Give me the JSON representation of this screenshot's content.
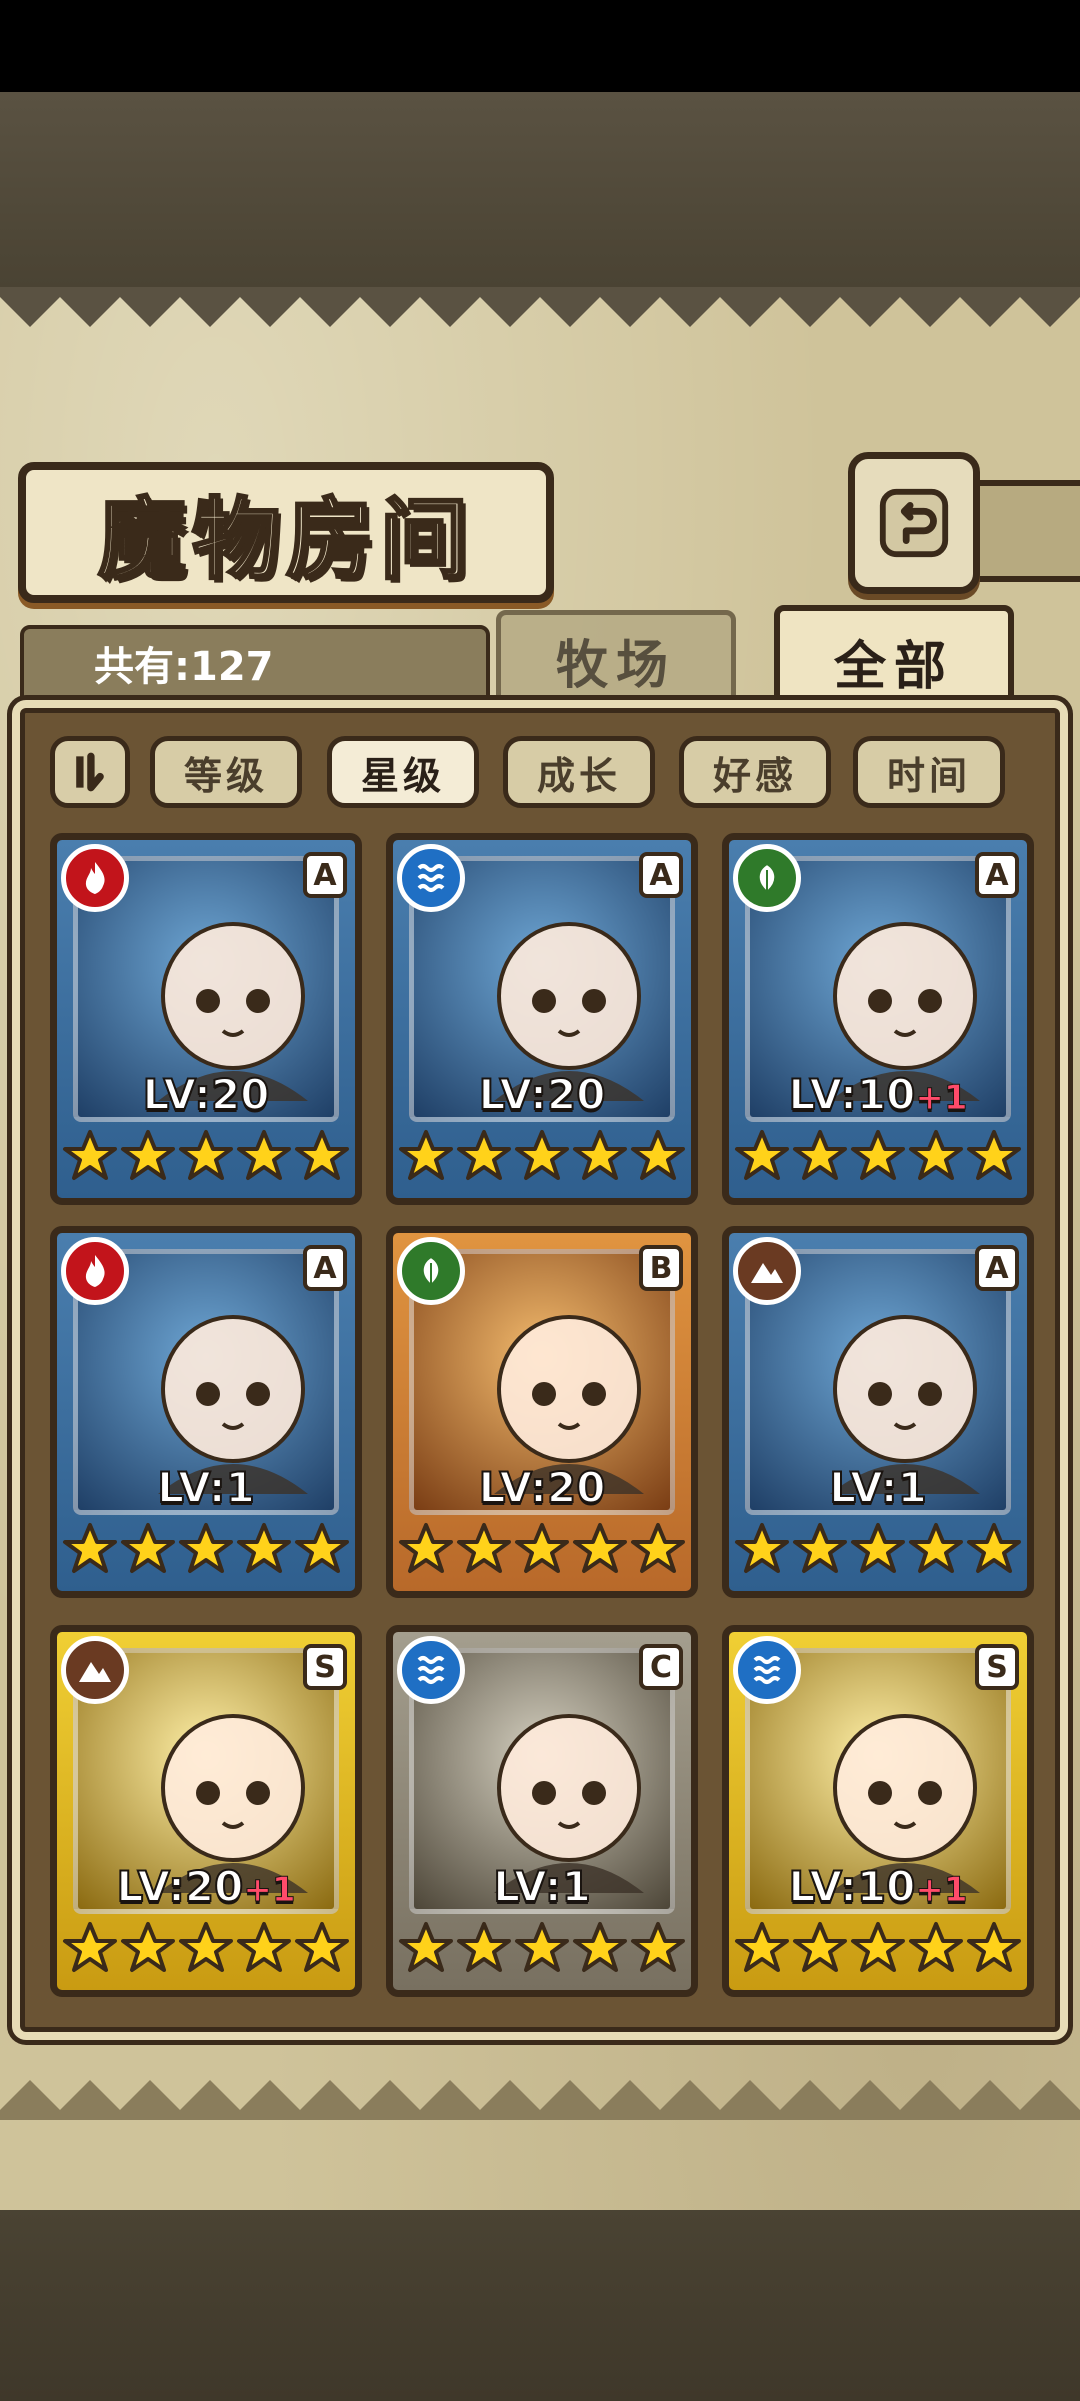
{
  "header": {
    "title": "魔物房间",
    "back_icon": "return-icon"
  },
  "summary": {
    "count_label": "共有:127"
  },
  "tabs": [
    {
      "label": "牧场",
      "active": false
    },
    {
      "label": "全部",
      "active": true
    }
  ],
  "sort": {
    "toggle_icon": "sort-order-icon",
    "options": [
      {
        "label": "等级",
        "active": false
      },
      {
        "label": "星级",
        "active": true
      },
      {
        "label": "成长",
        "active": false
      },
      {
        "label": "好感",
        "active": false
      },
      {
        "label": "时间",
        "active": false
      }
    ]
  },
  "monsters": [
    {
      "level": "LV:20",
      "plus": "",
      "rank": "A",
      "element": "fire",
      "frame": "blue",
      "stars": 5
    },
    {
      "level": "LV:20",
      "plus": "",
      "rank": "A",
      "element": "water",
      "frame": "blue",
      "stars": 5
    },
    {
      "level": "LV:10",
      "plus": "+1",
      "rank": "A",
      "element": "nature",
      "frame": "blue",
      "stars": 5
    },
    {
      "level": "LV:1",
      "plus": "",
      "rank": "A",
      "element": "fire",
      "frame": "blue",
      "stars": 5
    },
    {
      "level": "LV:20",
      "plus": "",
      "rank": "B",
      "element": "nature",
      "frame": "orange",
      "stars": 5
    },
    {
      "level": "LV:1",
      "plus": "",
      "rank": "A",
      "element": "earth",
      "frame": "blue",
      "stars": 5
    },
    {
      "level": "LV:20",
      "plus": "+1",
      "rank": "S",
      "element": "earth",
      "frame": "gold",
      "stars": 5
    },
    {
      "level": "LV:1",
      "plus": "",
      "rank": "C",
      "element": "water",
      "frame": "silver",
      "stars": 5
    },
    {
      "level": "LV:10",
      "plus": "+1",
      "rank": "S",
      "element": "water",
      "frame": "gold",
      "stars": 5
    }
  ],
  "colors": {
    "paper": "#cfc39a",
    "panel": "#6b5434",
    "outline": "#3a2a1a",
    "plus_text": "#ff4b6a",
    "star": "#ffd21a"
  }
}
